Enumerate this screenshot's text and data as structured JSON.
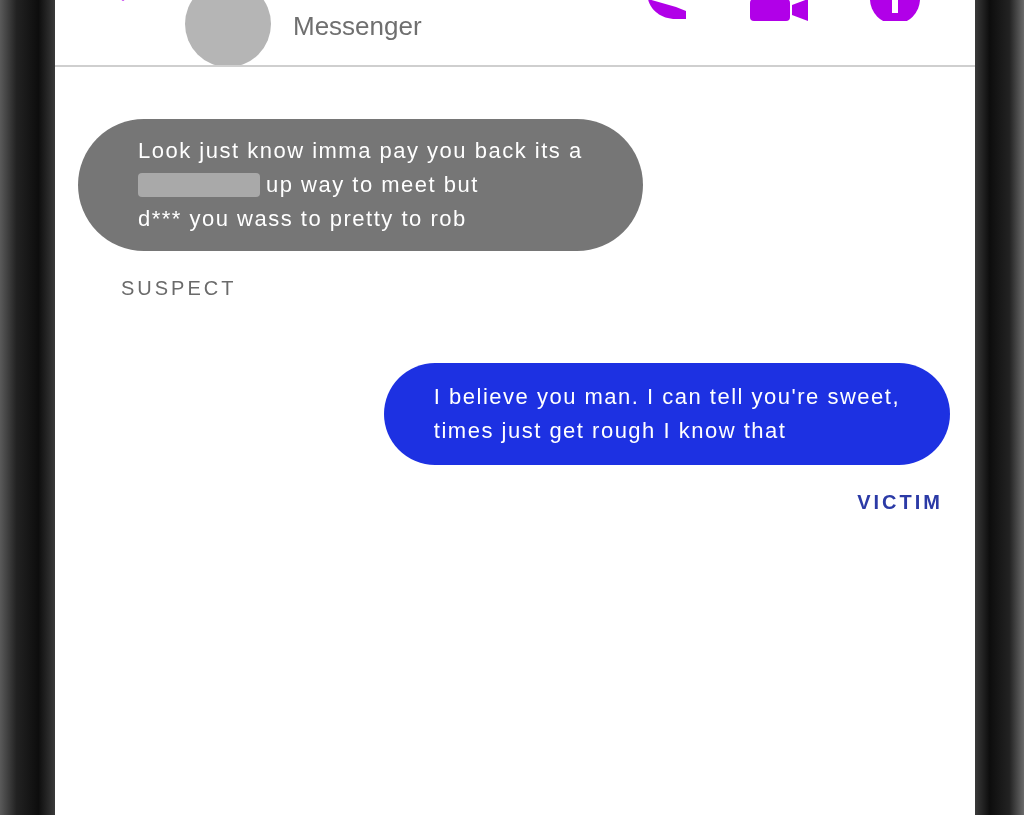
{
  "header": {
    "subtitle": "Messenger"
  },
  "messages": [
    {
      "kind": "received",
      "lines": [
        {
          "text": "Look just know imma pay you back its a",
          "redacted": false
        },
        {
          "text": "up way to meet but",
          "redacted": true
        },
        {
          "text": "d*** you wass to pretty to rob",
          "redacted": false
        }
      ],
      "label": "SUSPECT"
    },
    {
      "kind": "sent",
      "lines": [
        {
          "text": "I believe you man. I can tell you're sweet,",
          "redacted": false
        },
        {
          "text": "times just get rough I know that",
          "redacted": false
        }
      ],
      "label": "VICTIM"
    }
  ]
}
